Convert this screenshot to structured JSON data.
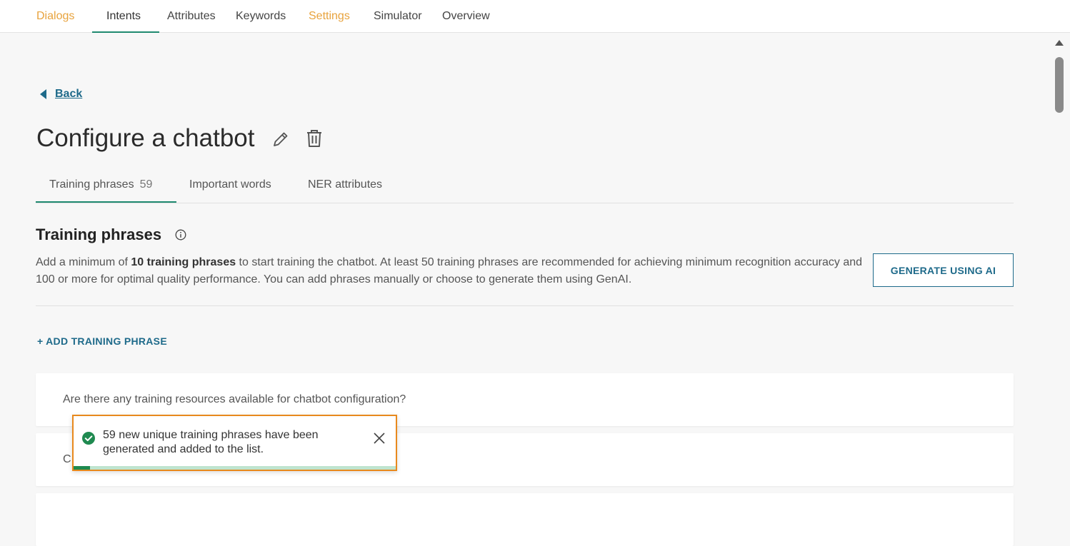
{
  "topnav": {
    "tabs": [
      {
        "label": "Dialogs",
        "style": "orange"
      },
      {
        "label": "Intents",
        "style": "active"
      },
      {
        "label": "Attributes",
        "style": "normal"
      },
      {
        "label": "Keywords",
        "style": "normal"
      },
      {
        "label": "Settings",
        "style": "orange"
      },
      {
        "label": "Simulator",
        "style": "normal"
      },
      {
        "label": "Overview",
        "style": "normal"
      }
    ]
  },
  "back": {
    "label": "Back"
  },
  "page": {
    "title": "Configure a chatbot"
  },
  "subtabs": {
    "training": {
      "label": "Training phrases",
      "count": "59"
    },
    "important": {
      "label": "Important words"
    },
    "ner": {
      "label": "NER attributes"
    }
  },
  "section": {
    "title": "Training phrases",
    "desc_pre": "Add a minimum of ",
    "desc_bold": "10 training phrases",
    "desc_post": " to start training the chatbot. At least 50 training phrases are recommended for achieving minimum recognition accuracy and 100 or more for optimal quality performance. You can add phrases manually or choose to generate them using GenAI.",
    "generate_label": "GENERATE USING AI",
    "add_label": "+ ADD TRAINING PHRASE"
  },
  "phrases": [
    "Are there any training resources available for chatbot configuration?",
    "C"
  ],
  "toast": {
    "message": "59 new unique training phrases have been generated and added to the list.",
    "progress": 0.05
  },
  "colors": {
    "accent_teal": "#1f8a70",
    "link_blue": "#1e6a8a",
    "orange": "#e8a33d",
    "toast_border": "#e8891d",
    "success_green": "#1f8a50"
  }
}
